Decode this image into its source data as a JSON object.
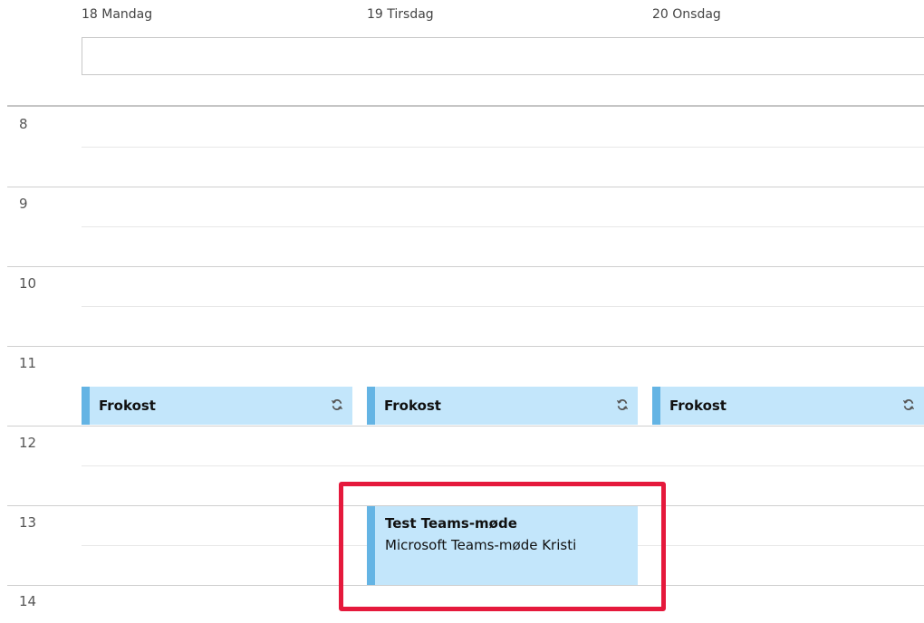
{
  "days": [
    {
      "label": "18 Mandag"
    },
    {
      "label": "19 Tirsdag"
    },
    {
      "label": "20 Onsdag"
    }
  ],
  "hours": [
    "8",
    "9",
    "10",
    "11",
    "12",
    "13",
    "14"
  ],
  "events": {
    "lunch": [
      {
        "title": "Frokost",
        "icon": "recurring-icon"
      },
      {
        "title": "Frokost",
        "icon": "recurring-icon"
      },
      {
        "title": "Frokost",
        "icon": "recurring-icon"
      }
    ],
    "teams": {
      "title": "Test Teams-møde",
      "subtitle": "Microsoft Teams-møde Kristi"
    }
  },
  "colors": {
    "event_background": "#c3e6fb",
    "event_accent": "#64b4e4",
    "highlight": "#e5193c"
  }
}
